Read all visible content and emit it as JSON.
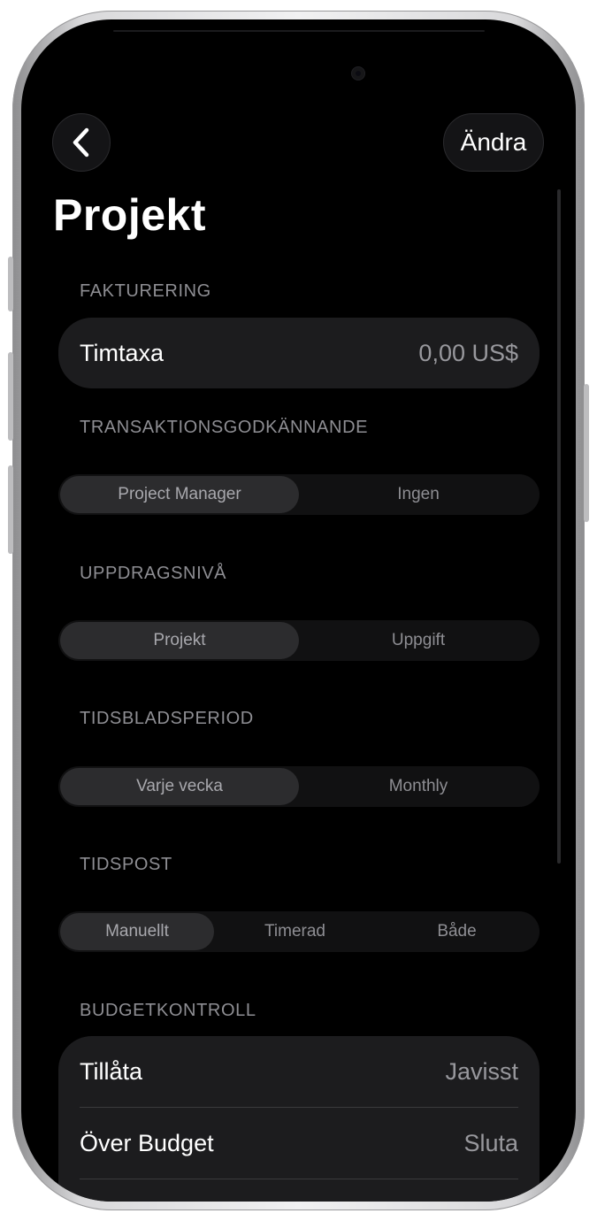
{
  "nav": {
    "back_icon": "chevron-left-icon",
    "edit_label": "Ändra"
  },
  "page": {
    "title": "Projekt"
  },
  "billing": {
    "section_label": "FAKTURERING",
    "hourly_rate": {
      "label": "Timtaxa",
      "value": "0,00 US$"
    }
  },
  "transaction_approval": {
    "section_label": "TRANSAKTIONSGODKÄNNANDE",
    "options": [
      "Project Manager",
      "Ingen"
    ],
    "selected": "Project Manager"
  },
  "assignment_level": {
    "section_label": "UPPDRAGSNIVÅ",
    "options": [
      "Projekt",
      "Uppgift"
    ],
    "selected": "Projekt"
  },
  "timesheet_period": {
    "section_label": "TIDSBLADSPERIOD",
    "options": [
      "Varje vecka",
      "Monthly"
    ],
    "selected": "Varje vecka"
  },
  "time_entry": {
    "section_label": "TIDSPOST",
    "options": [
      "Manuellt",
      "Timerad",
      "Både"
    ],
    "selected": "Manuellt"
  },
  "budget_control": {
    "section_label": "BUDGETKONTROLL",
    "rows": [
      {
        "label": "Tillåta",
        "value": "Javisst"
      },
      {
        "label": "Över Budget",
        "value": "Sluta"
      }
    ]
  },
  "colors": {
    "background": "#000000",
    "card": "#1c1c1e",
    "segment_selected": "#2c2c2e",
    "secondary_text": "#8e8e93"
  }
}
